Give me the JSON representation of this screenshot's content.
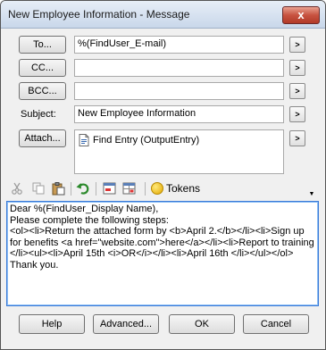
{
  "window": {
    "title": "New Employee Information - Message",
    "close_glyph": "x"
  },
  "buttons": {
    "to": "To...",
    "cc": "CC...",
    "bcc": "BCC...",
    "attach": "Attach..."
  },
  "fields": {
    "to_value": "%(FindUser_E-mail)",
    "cc_value": "",
    "bcc_value": "",
    "subject_label": "Subject:",
    "subject_value": "New Employee Information"
  },
  "arrow_button_label": ">",
  "attachments": [
    {
      "name": "Find Entry (OutputEntry)",
      "icon": "document-icon"
    }
  ],
  "toolbar": {
    "icons": [
      "cut-icon",
      "copy-icon",
      "paste-icon",
      "undo-icon",
      "insert-field-icon",
      "insert-table-icon",
      "tokens-icon"
    ],
    "tokens_label": "Tokens"
  },
  "message_body": [
    "Dear %(FindUser_Display Name),",
    "",
    "Please complete the following steps:",
    "<ol><li>Return the attached form by <b>April 2.</b></li><li>Sign up for benefits <a href=\"website.com\">here</a></li><li>Report to training </li><ul><li>April 15th <i>OR</i></li><li>April 16th </li></ul></ol>",
    "Thank you."
  ],
  "footer": {
    "help": "Help",
    "advanced": "Advanced...",
    "ok": "OK",
    "cancel": "Cancel"
  },
  "colors": {
    "title_gradient_top": "#e7eef7",
    "close_red": "#c75240",
    "focus_blue": "#3b7ad8"
  }
}
